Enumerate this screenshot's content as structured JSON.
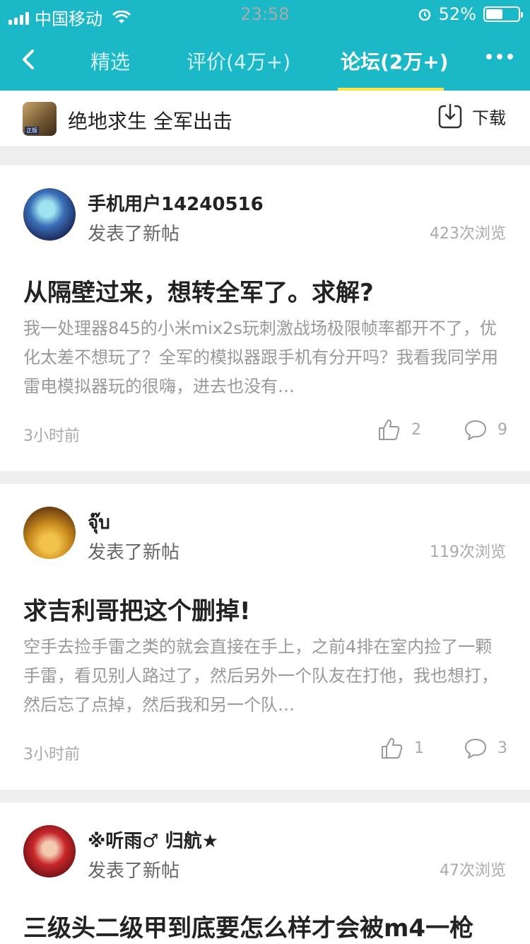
{
  "status_bar": {
    "carrier": "中国移动",
    "time": "23:58",
    "battery_percent": "52%",
    "battery_level": 0.52
  },
  "nav": {
    "tabs": [
      {
        "label": "精选"
      },
      {
        "label": "评价(4万+)"
      },
      {
        "label": "论坛(2万+)"
      }
    ],
    "active_tab": "论坛(2万+)",
    "accent_color": "#1bb8c8",
    "underline_color": "#ffe24a"
  },
  "app_bar": {
    "app_name": "绝地求生 全军出击",
    "download_label": "下载",
    "icon_tag": "正版"
  },
  "posts": [
    {
      "username": "手机用户14240516",
      "action": "发表了新帖",
      "views": "423次浏览",
      "title": "从隔壁过来，想转全军了。求解?",
      "excerpt": "我一处理器845的小米mix2s玩刺激战场极限帧率都开不了，优化太差不想玩了？全军的模拟器跟手机有分开吗？我看我同学用雷电模拟器玩的很嗨，进去也没有…",
      "time": "3小时前",
      "likes": "2",
      "comments": "9"
    },
    {
      "username": "จุ๊บ",
      "action": "发表了新帖",
      "views": "119次浏览",
      "title": "求吉利哥把这个删掉!",
      "excerpt": "空手去捡手雷之类的就会直接在手上，之前4排在室内捡了一颗手雷，看见别人路过了，然后另外一个队友在打他，我也想打，然后忘了点掉，然后我和另一个队…",
      "time": "3小时前",
      "likes": "1",
      "comments": "3"
    },
    {
      "username": "※听雨♂ 归航★",
      "action": "发表了新帖",
      "views": "47次浏览",
      "title": "三级头二级甲到底要怎么样才会被m4一枪"
    }
  ]
}
